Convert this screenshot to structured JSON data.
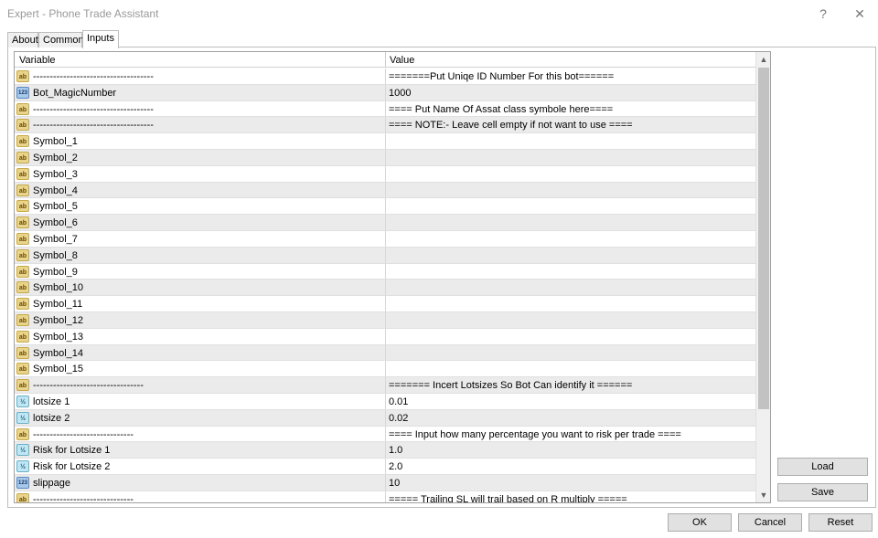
{
  "window": {
    "title": "Expert - Phone Trade Assistant",
    "help": "?",
    "close": "✕"
  },
  "tabs": [
    {
      "label": "About"
    },
    {
      "label": "Common"
    },
    {
      "label": "Inputs"
    }
  ],
  "grid": {
    "headers": {
      "variable": "Variable",
      "value": "Value"
    },
    "rows": [
      {
        "icon": "ab",
        "variable": "------------------------------------",
        "value": "=======Put Uniqe ID Number For this bot======"
      },
      {
        "icon": "123",
        "variable": "Bot_MagicNumber",
        "value": "1000"
      },
      {
        "icon": "ab",
        "variable": "------------------------------------",
        "value": "==== Put Name Of Assat class symbole here===="
      },
      {
        "icon": "ab",
        "variable": "------------------------------------",
        "value": "==== NOTE:- Leave cell empty if not want to use ===="
      },
      {
        "icon": "ab",
        "variable": "Symbol_1",
        "value": ""
      },
      {
        "icon": "ab",
        "variable": "Symbol_2",
        "value": ""
      },
      {
        "icon": "ab",
        "variable": "Symbol_3",
        "value": ""
      },
      {
        "icon": "ab",
        "variable": "Symbol_4",
        "value": ""
      },
      {
        "icon": "ab",
        "variable": "Symbol_5",
        "value": ""
      },
      {
        "icon": "ab",
        "variable": "Symbol_6",
        "value": ""
      },
      {
        "icon": "ab",
        "variable": "Symbol_7",
        "value": ""
      },
      {
        "icon": "ab",
        "variable": "Symbol_8",
        "value": ""
      },
      {
        "icon": "ab",
        "variable": "Symbol_9",
        "value": ""
      },
      {
        "icon": "ab",
        "variable": "Symbol_10",
        "value": ""
      },
      {
        "icon": "ab",
        "variable": "Symbol_11",
        "value": ""
      },
      {
        "icon": "ab",
        "variable": "Symbol_12",
        "value": ""
      },
      {
        "icon": "ab",
        "variable": "Symbol_13",
        "value": ""
      },
      {
        "icon": "ab",
        "variable": "Symbol_14",
        "value": ""
      },
      {
        "icon": "ab",
        "variable": "Symbol_15",
        "value": ""
      },
      {
        "icon": "ab",
        "variable": "---------------------------------",
        "value": "======= Incert Lotsizes So Bot Can identify it ======"
      },
      {
        "icon": "half",
        "variable": "lotsize 1",
        "value": "0.01"
      },
      {
        "icon": "half",
        "variable": "lotsize 2",
        "value": "0.02"
      },
      {
        "icon": "ab",
        "variable": "------------------------------",
        "value": "==== Input how many percentage you want to risk per trade ===="
      },
      {
        "icon": "half",
        "variable": "Risk for Lotsize 1",
        "value": "1.0"
      },
      {
        "icon": "half",
        "variable": "Risk for Lotsize 2",
        "value": "2.0"
      },
      {
        "icon": "123",
        "variable": "slippage",
        "value": "10"
      },
      {
        "icon": "ab",
        "variable": "------------------------------",
        "value": "===== Trailing SL will trail based on R multiply ====="
      }
    ]
  },
  "buttons": {
    "load": "Load",
    "save": "Save",
    "ok": "OK",
    "cancel": "Cancel",
    "reset": "Reset"
  },
  "icon_text": {
    "ab": "ab",
    "123": "123",
    "half": "½"
  },
  "scroll": {
    "up": "▲",
    "down": "▼"
  }
}
